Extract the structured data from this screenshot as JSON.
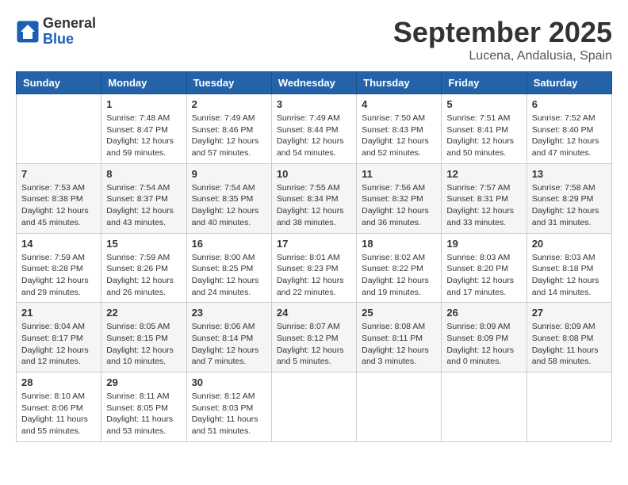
{
  "header": {
    "logo_general": "General",
    "logo_blue": "Blue",
    "month": "September 2025",
    "location": "Lucena, Andalusia, Spain"
  },
  "weekdays": [
    "Sunday",
    "Monday",
    "Tuesday",
    "Wednesday",
    "Thursday",
    "Friday",
    "Saturday"
  ],
  "weeks": [
    [
      {
        "day": "",
        "info": ""
      },
      {
        "day": "1",
        "info": "Sunrise: 7:48 AM\nSunset: 8:47 PM\nDaylight: 12 hours\nand 59 minutes."
      },
      {
        "day": "2",
        "info": "Sunrise: 7:49 AM\nSunset: 8:46 PM\nDaylight: 12 hours\nand 57 minutes."
      },
      {
        "day": "3",
        "info": "Sunrise: 7:49 AM\nSunset: 8:44 PM\nDaylight: 12 hours\nand 54 minutes."
      },
      {
        "day": "4",
        "info": "Sunrise: 7:50 AM\nSunset: 8:43 PM\nDaylight: 12 hours\nand 52 minutes."
      },
      {
        "day": "5",
        "info": "Sunrise: 7:51 AM\nSunset: 8:41 PM\nDaylight: 12 hours\nand 50 minutes."
      },
      {
        "day": "6",
        "info": "Sunrise: 7:52 AM\nSunset: 8:40 PM\nDaylight: 12 hours\nand 47 minutes."
      }
    ],
    [
      {
        "day": "7",
        "info": "Sunrise: 7:53 AM\nSunset: 8:38 PM\nDaylight: 12 hours\nand 45 minutes."
      },
      {
        "day": "8",
        "info": "Sunrise: 7:54 AM\nSunset: 8:37 PM\nDaylight: 12 hours\nand 43 minutes."
      },
      {
        "day": "9",
        "info": "Sunrise: 7:54 AM\nSunset: 8:35 PM\nDaylight: 12 hours\nand 40 minutes."
      },
      {
        "day": "10",
        "info": "Sunrise: 7:55 AM\nSunset: 8:34 PM\nDaylight: 12 hours\nand 38 minutes."
      },
      {
        "day": "11",
        "info": "Sunrise: 7:56 AM\nSunset: 8:32 PM\nDaylight: 12 hours\nand 36 minutes."
      },
      {
        "day": "12",
        "info": "Sunrise: 7:57 AM\nSunset: 8:31 PM\nDaylight: 12 hours\nand 33 minutes."
      },
      {
        "day": "13",
        "info": "Sunrise: 7:58 AM\nSunset: 8:29 PM\nDaylight: 12 hours\nand 31 minutes."
      }
    ],
    [
      {
        "day": "14",
        "info": "Sunrise: 7:59 AM\nSunset: 8:28 PM\nDaylight: 12 hours\nand 29 minutes."
      },
      {
        "day": "15",
        "info": "Sunrise: 7:59 AM\nSunset: 8:26 PM\nDaylight: 12 hours\nand 26 minutes."
      },
      {
        "day": "16",
        "info": "Sunrise: 8:00 AM\nSunset: 8:25 PM\nDaylight: 12 hours\nand 24 minutes."
      },
      {
        "day": "17",
        "info": "Sunrise: 8:01 AM\nSunset: 8:23 PM\nDaylight: 12 hours\nand 22 minutes."
      },
      {
        "day": "18",
        "info": "Sunrise: 8:02 AM\nSunset: 8:22 PM\nDaylight: 12 hours\nand 19 minutes."
      },
      {
        "day": "19",
        "info": "Sunrise: 8:03 AM\nSunset: 8:20 PM\nDaylight: 12 hours\nand 17 minutes."
      },
      {
        "day": "20",
        "info": "Sunrise: 8:03 AM\nSunset: 8:18 PM\nDaylight: 12 hours\nand 14 minutes."
      }
    ],
    [
      {
        "day": "21",
        "info": "Sunrise: 8:04 AM\nSunset: 8:17 PM\nDaylight: 12 hours\nand 12 minutes."
      },
      {
        "day": "22",
        "info": "Sunrise: 8:05 AM\nSunset: 8:15 PM\nDaylight: 12 hours\nand 10 minutes."
      },
      {
        "day": "23",
        "info": "Sunrise: 8:06 AM\nSunset: 8:14 PM\nDaylight: 12 hours\nand 7 minutes."
      },
      {
        "day": "24",
        "info": "Sunrise: 8:07 AM\nSunset: 8:12 PM\nDaylight: 12 hours\nand 5 minutes."
      },
      {
        "day": "25",
        "info": "Sunrise: 8:08 AM\nSunset: 8:11 PM\nDaylight: 12 hours\nand 3 minutes."
      },
      {
        "day": "26",
        "info": "Sunrise: 8:09 AM\nSunset: 8:09 PM\nDaylight: 12 hours\nand 0 minutes."
      },
      {
        "day": "27",
        "info": "Sunrise: 8:09 AM\nSunset: 8:08 PM\nDaylight: 11 hours\nand 58 minutes."
      }
    ],
    [
      {
        "day": "28",
        "info": "Sunrise: 8:10 AM\nSunset: 8:06 PM\nDaylight: 11 hours\nand 55 minutes."
      },
      {
        "day": "29",
        "info": "Sunrise: 8:11 AM\nSunset: 8:05 PM\nDaylight: 11 hours\nand 53 minutes."
      },
      {
        "day": "30",
        "info": "Sunrise: 8:12 AM\nSunset: 8:03 PM\nDaylight: 11 hours\nand 51 minutes."
      },
      {
        "day": "",
        "info": ""
      },
      {
        "day": "",
        "info": ""
      },
      {
        "day": "",
        "info": ""
      },
      {
        "day": "",
        "info": ""
      }
    ]
  ]
}
